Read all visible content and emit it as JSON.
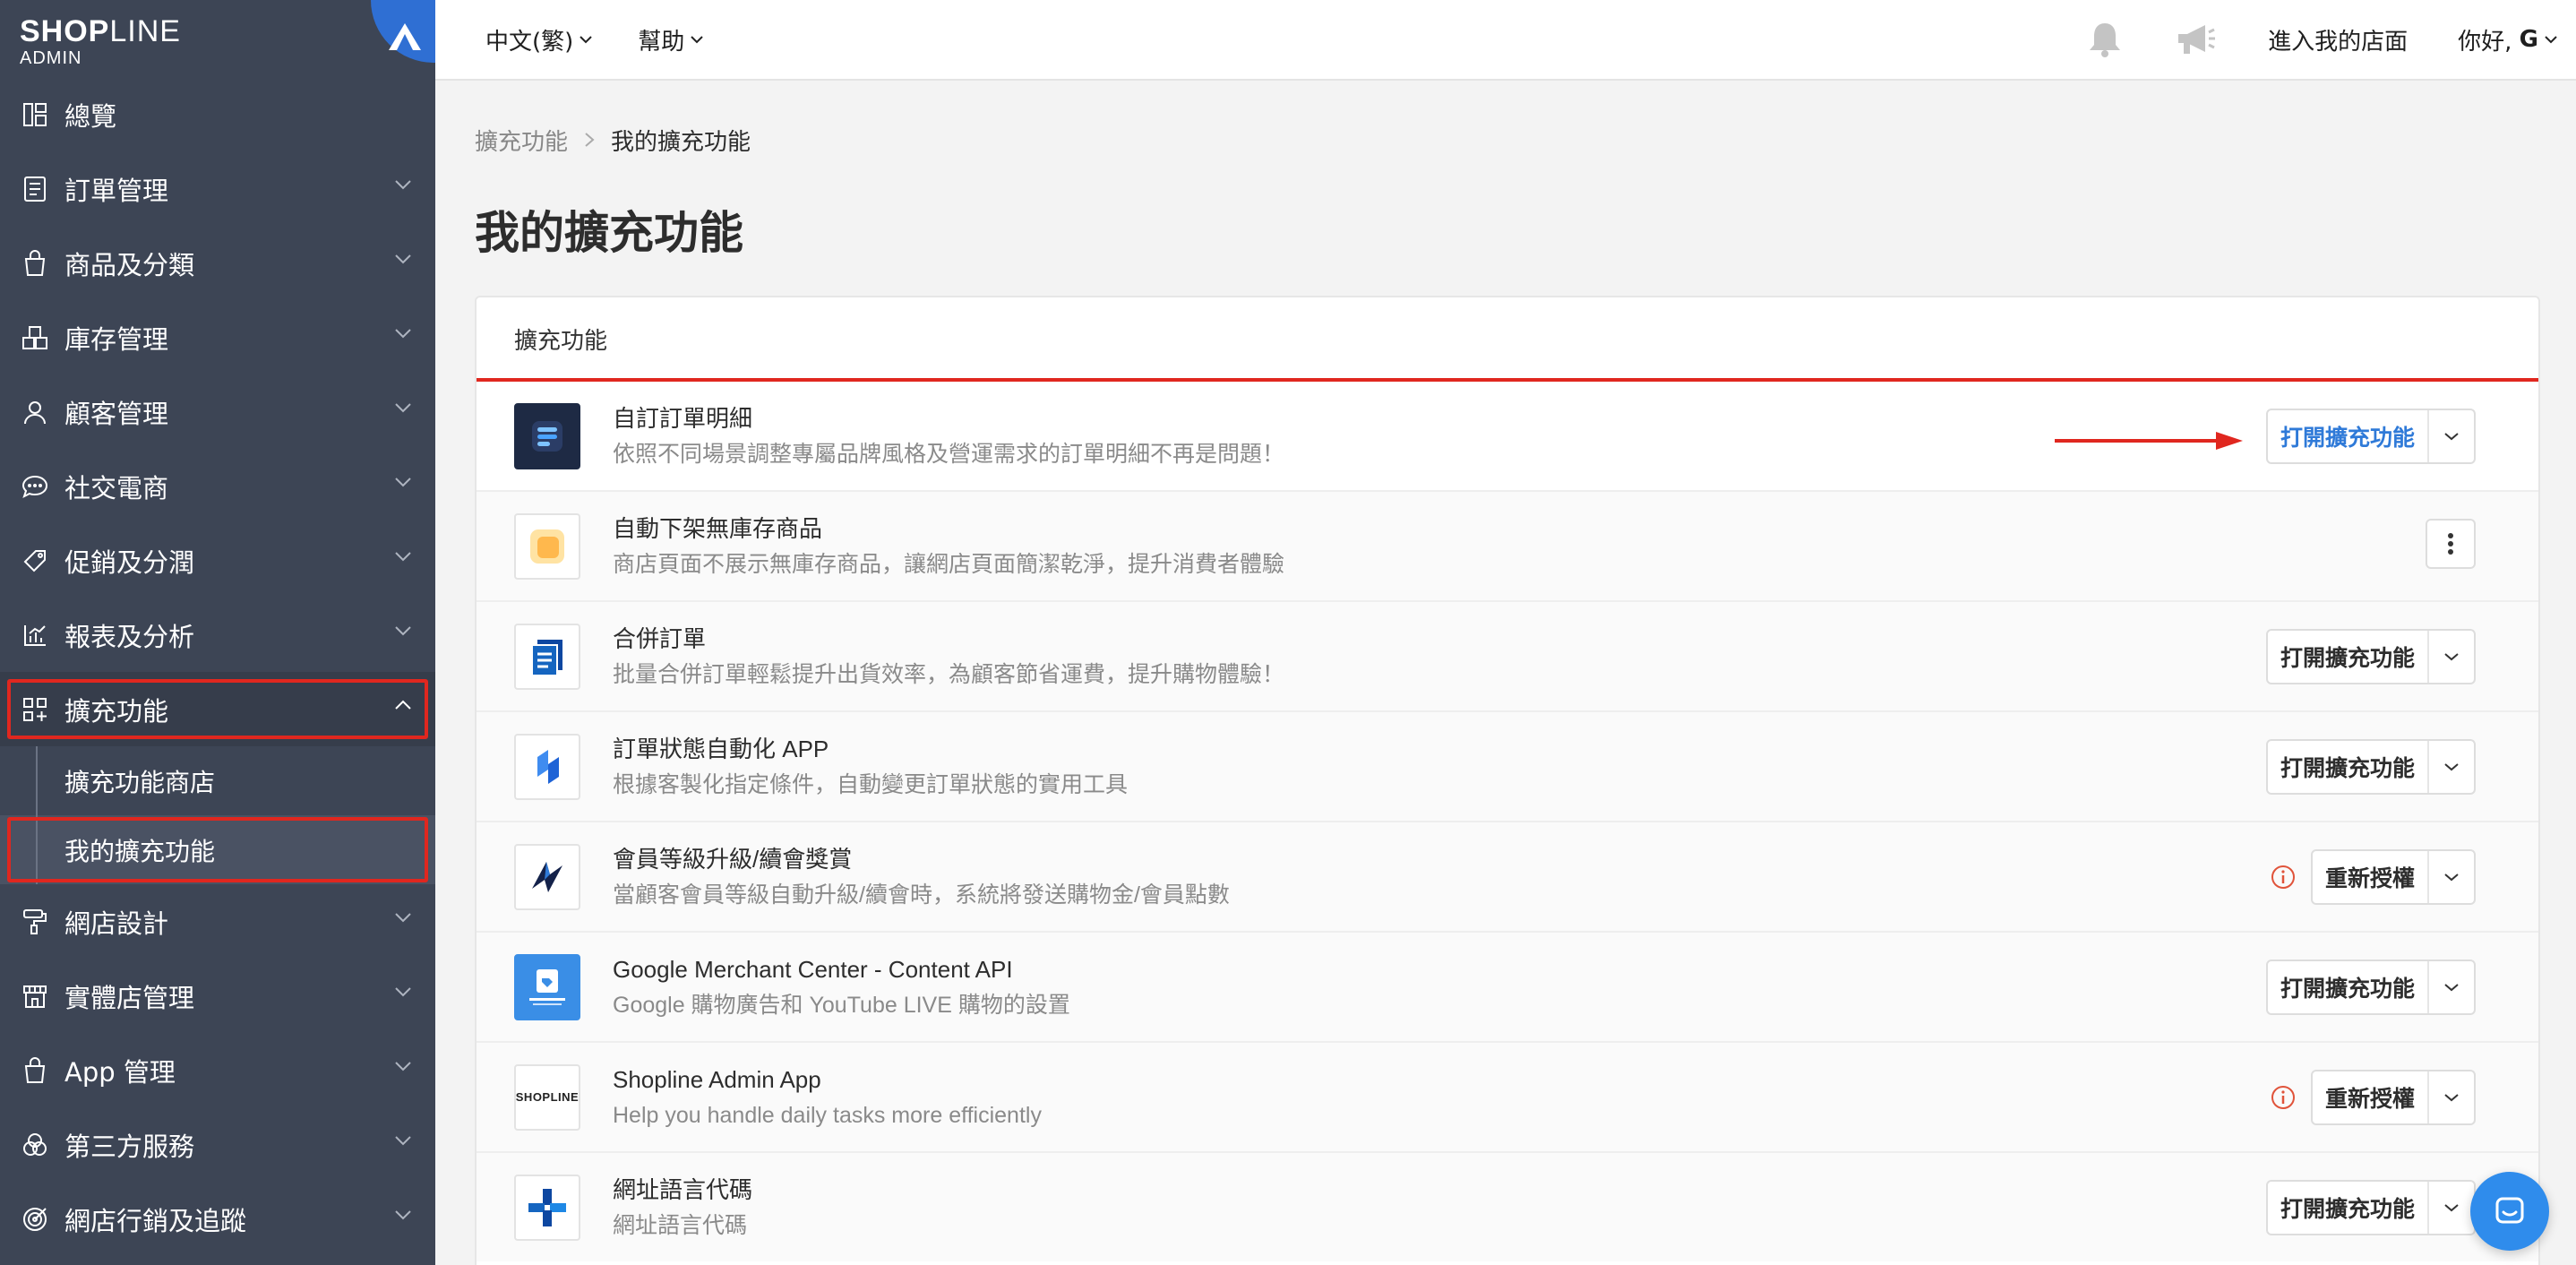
{
  "colors": {
    "sidebar_bg": "#3d4555",
    "accent_blue": "#2f7ad8",
    "highlight_red": "#e0271f",
    "chat_blue": "#2f8cec"
  },
  "brand": {
    "name_bold": "SHOP",
    "name_thin": "LINE",
    "sub": "ADMIN"
  },
  "sidebar": {
    "items": [
      {
        "label": "總覽",
        "icon": "dashboard-icon"
      },
      {
        "label": "訂單管理",
        "icon": "order-icon"
      },
      {
        "label": "商品及分類",
        "icon": "shopping-bag-icon"
      },
      {
        "label": "庫存管理",
        "icon": "inventory-icon"
      },
      {
        "label": "顧客管理",
        "icon": "person-icon"
      },
      {
        "label": "社交電商",
        "icon": "chat-bubble-icon"
      },
      {
        "label": "促銷及分潤",
        "icon": "tag-icon"
      },
      {
        "label": "報表及分析",
        "icon": "chart-icon"
      },
      {
        "label": "擴充功能",
        "icon": "apps-icon"
      },
      {
        "label": "網店設計",
        "icon": "paint-roller-icon"
      },
      {
        "label": "實體店管理",
        "icon": "store-icon"
      },
      {
        "label": "App 管理",
        "icon": "bag-icon"
      },
      {
        "label": "第三方服務",
        "icon": "circles-icon"
      },
      {
        "label": "網店行銷及追蹤",
        "icon": "target-icon"
      }
    ],
    "sub_items": [
      {
        "label": "擴充功能商店"
      },
      {
        "label": "我的擴充功能"
      }
    ]
  },
  "topbar": {
    "language": "中文(繁)",
    "help": "幫助",
    "store_link": "進入我的店面",
    "greeting": "你好,",
    "user": "G"
  },
  "breadcrumb": {
    "parent": "擴充功能",
    "current": "我的擴充功能"
  },
  "page_title": "我的擴充功能",
  "card_title": "擴充功能",
  "apps": [
    {
      "name": "自訂訂單明細",
      "desc": "依照不同場景調整專屬品牌風格及營運需求的訂單明細不再是問題！",
      "action": "打開擴充功能",
      "logo": "invoice-app-logo-icon"
    },
    {
      "name": "自動下架無庫存商品",
      "desc": "商店頁面不展示無庫存商品，讓網店頁面簡潔乾淨，提升消費者體驗",
      "action": "",
      "logo": "auto-unpublish-logo-icon"
    },
    {
      "name": "合併訂單",
      "desc": "批量合併訂單輕鬆提升出貨效率，為顧客節省運費，提升購物體驗！",
      "action": "打開擴充功能",
      "logo": "merge-order-logo-icon"
    },
    {
      "name": "訂單狀態自動化 APP",
      "desc": "根據客製化指定條件，自動變更訂單狀態的實用工具",
      "action": "打開擴充功能",
      "logo": "order-automation-logo-icon"
    },
    {
      "name": "會員等級升級/續會獎賞",
      "desc": "當顧客會員等級自動升級/續會時，系統將發送購物金/會員點數",
      "action": "重新授權",
      "logo": "membership-logo-icon"
    },
    {
      "name": "Google Merchant Center - Content API",
      "desc": "Google 購物廣告和 YouTube LIVE 購物的設置",
      "action": "打開擴充功能",
      "logo": "google-merchant-logo-icon"
    },
    {
      "name": "Shopline Admin App",
      "desc": "Help you handle daily tasks more efficiently",
      "action": "重新授權",
      "logo": "shopline-logo-icon",
      "logo_text": "SHOPLINE"
    },
    {
      "name": "網址語言代碼",
      "desc": "網址語言代碼",
      "action": "打開擴充功能",
      "logo": "url-language-logo-icon"
    }
  ]
}
